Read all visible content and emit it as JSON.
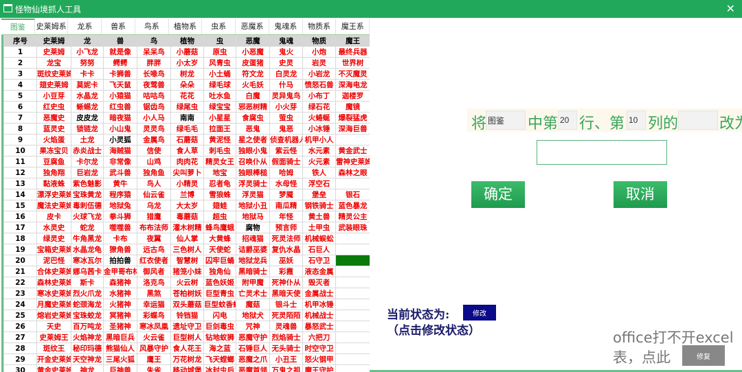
{
  "window": {
    "title": "怪物仙境抓人工具",
    "close": "✕"
  },
  "tabs": [
    "图鉴",
    "史莱姆系",
    "龙系",
    "兽系",
    "鸟系",
    "植物系",
    "虫系",
    "恶魔系",
    "鬼魂系",
    "物质系",
    "魔王系"
  ],
  "table": {
    "headers": [
      "序号",
      "史莱姆",
      "龙",
      "兽",
      "鸟",
      "植物",
      "虫",
      "恶魔",
      "鬼魂",
      "物质",
      "魔王"
    ],
    "rows": [
      [
        "史莱姆",
        "小飞龙",
        "就是像",
        "呆呆鸟",
        "小蘑菇",
        "原虫",
        "小恶魔",
        "鬼火",
        "小炮",
        "最终兵器"
      ],
      [
        "龙宝",
        "努努",
        "鳄鳄",
        "胖胖",
        "小太岁",
        "风青虫",
        "皮蛋猪",
        "史灵",
        "岩灵",
        "世界树"
      ],
      [
        "斑纹史莱姆",
        "卡卡",
        "卡狮兽",
        "长喙鸟",
        "树龙",
        "小土蛹",
        "符文龙",
        "白灵龙",
        "小岩龙",
        "不灭魔灵"
      ],
      [
        "翅史莱姆",
        "莫妮卡",
        "飞天鼠",
        "夜莺兽",
        "朵朵",
        "绿毛球",
        "火毛妖",
        "什马",
        "愤怒石兽",
        "深海电龙"
      ],
      [
        "小豆芽",
        "水晶龙",
        "小猿猫",
        "咕咕鸟",
        "花花",
        "吐水鱼",
        "白魔",
        "灵异鬼鸟",
        "小布丁",
        "迦楼罗"
      ],
      [
        "红史虫",
        "蜥蜴龙",
        "红虫兽",
        "锯齿鸟",
        "绿尾虫",
        "绿宝宝",
        "邪恶树精",
        "小火芽",
        "绿石花",
        "魔镜"
      ],
      [
        "恶魔史",
        "皮皮龙",
        "暗夜猫",
        "小人马",
        "南南",
        "小星星",
        "食腐虫",
        "萤虫",
        "火蜷蜒",
        "爆裂猛虎"
      ],
      [
        "蓝灵史",
        "锁链龙",
        "小山鬼",
        "灵灵鸟",
        "绿毛毛",
        "拉面王",
        "恶鬼",
        "鬼恶",
        "小冰锤",
        "深海巨兽"
      ],
      [
        "火焰蛋",
        "土龙",
        "小灵狐",
        "金属鸟",
        "石蘑菇",
        "黄泥怪",
        "星之使者",
        "侦查机器人",
        "机甲小人",
        ""
      ],
      [
        "果冻宝贝",
        "赤炎战士",
        "海贼猫",
        "信使",
        "食人草",
        "刺毛虫",
        "独眼小鬼",
        "紫云怪",
        "水元素",
        "黄金武士"
      ],
      [
        "豆腐鱼",
        "卡尔龙",
        "非常像",
        "山鸡",
        "肉肉花",
        "精灵女王",
        "召唤仆从",
        "假面骑士",
        "火元素",
        "雷神史莱姆"
      ],
      [
        "独角翔",
        "巨岩龙",
        "武斗兽",
        "独角鱼",
        "尖叫萝卜",
        "地宝",
        "独眼棒槌",
        "哈姆",
        "铁人",
        "森林之眼"
      ],
      [
        "黏液蛛",
        "紫色魅影",
        "黄牛",
        "鸟人",
        "小精灵",
        "忍者龟",
        "浮灵骑士",
        "水母怪",
        "浮空石",
        ""
      ],
      [
        "漂浮史莱姆",
        "宝珠黄龙",
        "程序猿",
        "仙云雀",
        "兰博",
        "雪狼蛛",
        "浮灵猫",
        "梦魇",
        "堡垒",
        "银石"
      ],
      [
        "魔法史莱姆",
        "毒刺伍德",
        "地狱兔",
        "乌龙",
        "大太岁",
        "翅蛙",
        "地狱小丑",
        "南瓜精",
        "钢铁骑士",
        "蓝色暴龙"
      ],
      [
        "皮卡",
        "火球飞龙",
        "拳斗狮",
        "猎鹰",
        "毒蘑菇",
        "超虫",
        "地狱马",
        "年怪",
        "黄土兽",
        "精灵公主"
      ],
      [
        "水灵史",
        "蛇龙",
        "噬噬兽",
        "布布法师",
        "灌木树精",
        "蜂鸟鹰蛾",
        "腐物",
        "预言师",
        "土甲虫",
        "武装眼珠"
      ],
      [
        "绿灵史",
        "牛角黑龙",
        "卡布",
        "夜翼",
        "仙人掌",
        "大黄蜂",
        "招魂猫",
        "死灵法师",
        "机械蜈蚣",
        ""
      ],
      [
        "宝箱史莱姆",
        "水晶龙龟",
        "獠角兽",
        "远古鸟",
        "三色树人",
        "天使蛇",
        "诘爵巫婆",
        "复仇水晶",
        "石巨人",
        ""
      ],
      [
        "泥巴怪",
        "寒冰瓦尔",
        "拍拍兽",
        "红衣使者",
        "智慧树",
        "囚牢巨蛹",
        "地狱龙兵",
        "巫妖",
        "石守卫",
        ""
      ],
      [
        "合体史莱姆",
        "娜乌茜卡",
        "金甲哥布林",
        "御风者",
        "猪笼小妹",
        "独角仙",
        "黑暗骑士",
        "彩霞",
        "液态金属",
        ""
      ],
      [
        "森林史莱姆",
        "斯卡",
        "森猪神",
        "洛克鸟",
        "火云树",
        "蓝色妖姬",
        "附甲魔",
        "死神仆从",
        "毁灭者",
        ""
      ],
      [
        "寒冰史莱姆",
        "烈火爪龙",
        "水猪神",
        "黑煞",
        "苍柏树妖",
        "巨型青虫",
        "亡灵术士",
        "黑暗天使",
        "金属战士",
        ""
      ],
      [
        "月魔史莱姆",
        "蛇颈海龙",
        "火猪神",
        "幸运猫",
        "双头蘑菇",
        "巨型蚊香蛙",
        "魔菇",
        "银斗士",
        "机甲冰锤",
        ""
      ],
      [
        "熔岩史莱姆",
        "宝珠蛟龙",
        "冥猪神",
        "彩蝶鸟",
        "铃铛猫",
        "闪电",
        "地狱犬",
        "死灵陌陌",
        "机械战士",
        ""
      ],
      [
        "天史",
        "百万吨龙",
        "圣猪神",
        "寒冰凤凰",
        "遗址守卫",
        "巨剑毒虫",
        "咒神",
        "灵魂兽",
        "暴怒武士",
        ""
      ],
      [
        "史莱姆王",
        "火焰神龙",
        "黑暗巨兵",
        "火云雀",
        "巨型树人",
        "钻地蚁狮",
        "恶魔守护",
        "烈焰骑士",
        "六把刀",
        ""
      ],
      [
        "斑纹王",
        "秘印玛德",
        "熊猫仙人",
        "风暴守护",
        "食人花王",
        "海之蓝",
        "石锤巨人",
        "无头骑士",
        "时空守卫",
        ""
      ],
      [
        "开金史莱姆",
        "天空神龙",
        "三尾火狐",
        "鹰王",
        "万花树龙",
        "飞天螳螂",
        "恶魔之爪",
        "小丑王",
        "怒火钢甲",
        ""
      ],
      [
        "黄金史莱姆",
        "神龙",
        "巨神兽",
        "朱雀",
        "移动城堡",
        "冰封虫后",
        "恶魔首领",
        "万鬼之祖",
        "魔王守护",
        ""
      ]
    ],
    "black_cells": [
      [
        7,
        2
      ],
      [
        7,
        5
      ],
      [
        9,
        3
      ],
      [
        17,
        7
      ],
      [
        20,
        3
      ]
    ],
    "selected_cell": [
      20,
      10
    ],
    "colors": {
      "text": "#ee0000",
      "selected": "#0a7a0a"
    }
  },
  "form": {
    "t1": "将",
    "sheet": "图鉴",
    "t2": "中第",
    "row": "20",
    "t3": "行、第",
    "col": "10",
    "t4": "列的",
    "old": "",
    "t5": "改为",
    "new_value": "",
    "ok": "确定",
    "cancel": "取消"
  },
  "status": {
    "label": "当前状态为:",
    "mode": "修改",
    "hint": "（点击修改状态）"
  },
  "repair": {
    "line1": "office打不开excel",
    "line2": "表，点此",
    "button": "修复"
  }
}
